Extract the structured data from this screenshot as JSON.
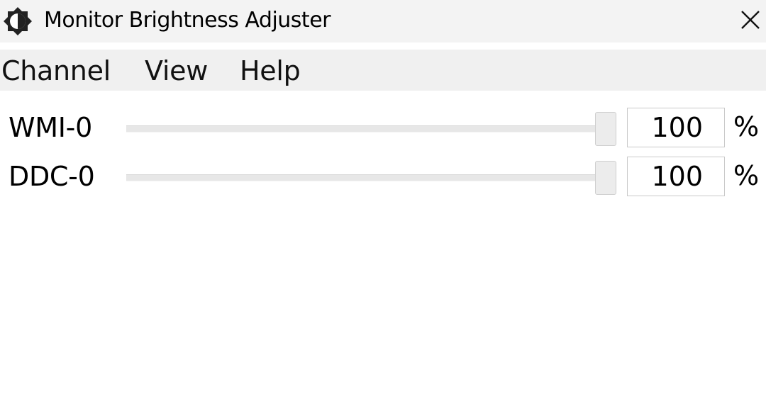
{
  "window": {
    "title": "Monitor Brightness Adjuster",
    "app_icon": "brightness-icon",
    "close_icon": "close-icon"
  },
  "menu": {
    "items": [
      {
        "label": "Channel"
      },
      {
        "label": "View"
      },
      {
        "label": "Help"
      }
    ]
  },
  "channels": [
    {
      "label": "WMI-0",
      "value": "100",
      "unit": "%",
      "slider_level_percent": 100
    },
    {
      "label": "DDC-0",
      "value": "100",
      "unit": "%",
      "slider_level_percent": 100
    }
  ],
  "colors": {
    "titlebar_bg": "#f3f3f3",
    "menubar_bg": "#f0f0f0",
    "track": "#e7e7e7",
    "thumb": "#ececec"
  }
}
